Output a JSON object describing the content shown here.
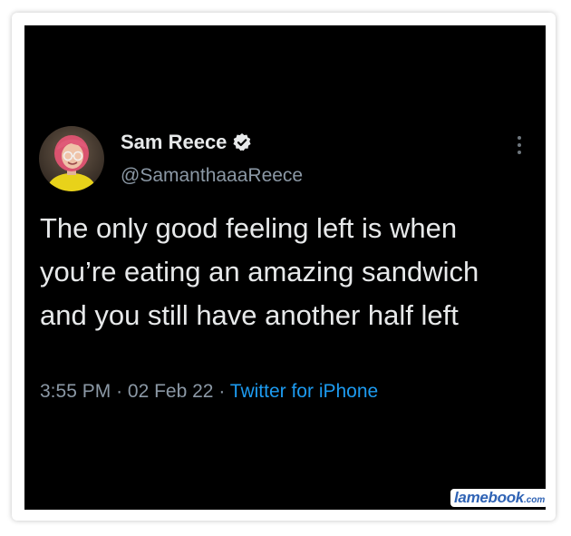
{
  "tweet": {
    "author_name": "Sam Reece",
    "author_handle": "@SamanthaaaReece",
    "text": "The only good feeling left is when you’re eating an amazing sandwich and you still have another half left",
    "time": "3:55 PM",
    "date": "02 Feb 22",
    "separator": "·",
    "source": "Twitter for iPhone",
    "verified_icon": "verified-badge-icon",
    "more_icon": "more-options-icon"
  },
  "watermark": {
    "brand": "lamebook",
    "tld": ".com"
  },
  "colors": {
    "background": "#000000",
    "text_primary": "#e7e9ea",
    "text_secondary": "#8b98a5",
    "link": "#1d9bf0",
    "watermark": "#2f63b5"
  }
}
